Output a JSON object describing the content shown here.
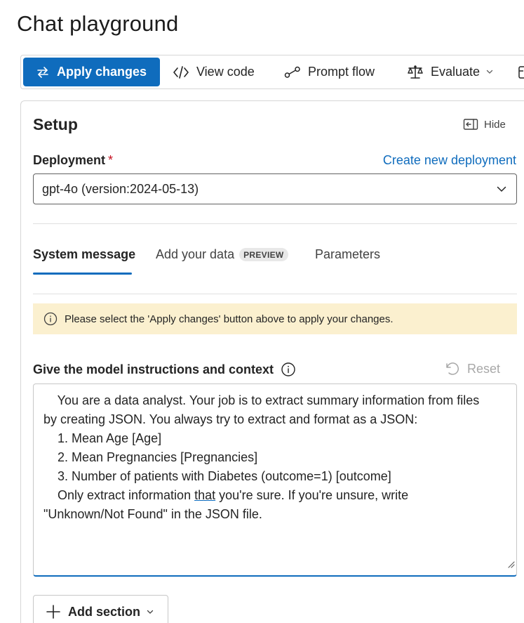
{
  "page": {
    "title": "Chat playground"
  },
  "toolbar": {
    "apply_label": "Apply changes",
    "apply_icon": "arrows-swap-icon",
    "view_code_label": "View code",
    "view_code_icon": "code-icon",
    "prompt_flow_label": "Prompt flow",
    "prompt_flow_icon": "flow-icon",
    "evaluate_label": "Evaluate",
    "evaluate_icon": "scale-icon",
    "more_icon": "overflow-icon"
  },
  "setup": {
    "title": "Setup",
    "hide_label": "Hide",
    "deployment_label": "Deployment",
    "required_marker": "*",
    "create_link": "Create new deployment",
    "deployment_value": "gpt-4o (version:2024-05-13)"
  },
  "tabs": [
    {
      "label": "System message",
      "selected": true
    },
    {
      "label": "Add your data",
      "badge": "PREVIEW",
      "selected": false
    },
    {
      "label": "Parameters",
      "selected": false
    }
  ],
  "banner": {
    "text": "Please select the 'Apply changes' button above to apply your changes."
  },
  "instructions": {
    "label": "Give the model instructions and context",
    "reset_label": "Reset",
    "lines": [
      "    You are a data analyst. Your job is to extract summary information from files",
      "by creating JSON. You always try to extract and format as a JSON:",
      "    1. Mean Age [Age]",
      "    2. Mean Pregnancies [Pregnancies]",
      "    3. Number of patients with Diabetes (outcome=1) [outcome]"
    ],
    "line6_before": "    Only extract information ",
    "line6_underlined": "that",
    "line6_after": " you're sure. If you're unsure, write",
    "line7": "\"Unknown/Not Found\" in the JSON file."
  },
  "add_section_label": "Add section",
  "colors": {
    "accent": "#0f6cbd",
    "banner_bg": "#fbf0cf",
    "required": "#c50f1f"
  }
}
